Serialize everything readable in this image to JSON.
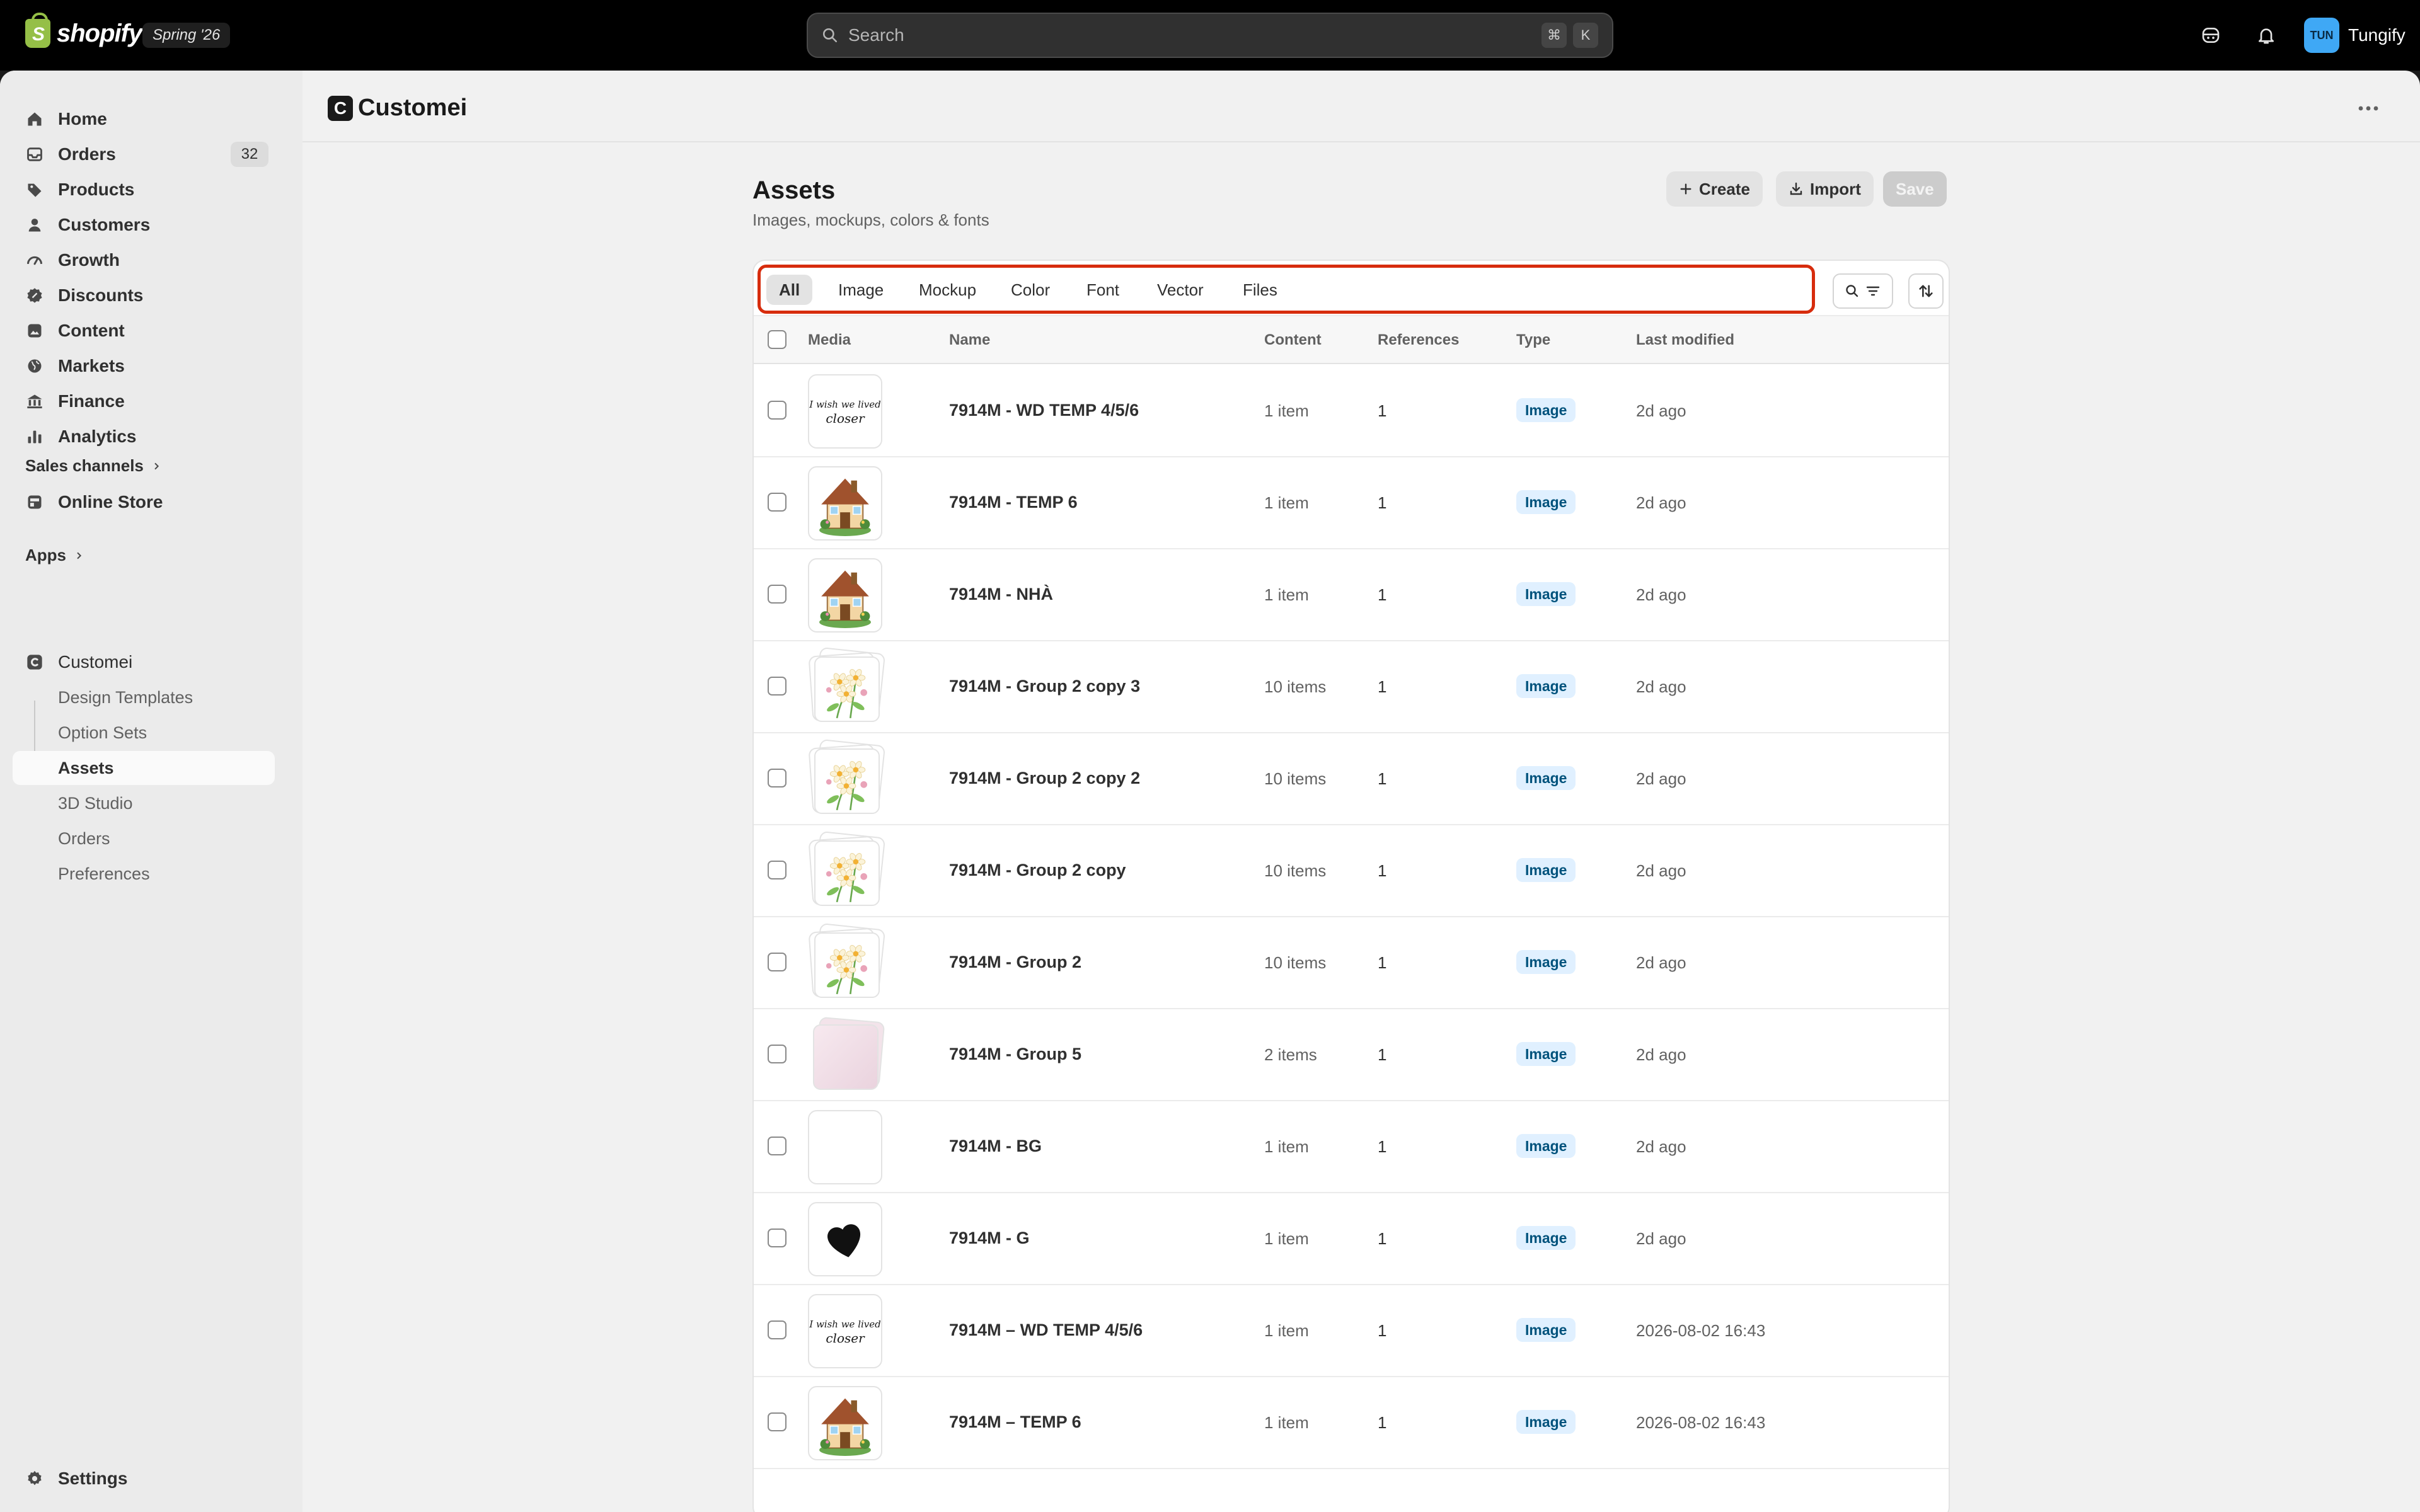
{
  "topbar": {
    "brand": "shopify",
    "brand_initial": "S",
    "edition": "Spring '26",
    "search_placeholder": "Search",
    "shortcut_keys": [
      "⌘",
      "K"
    ],
    "user_initials": "TUN",
    "user_name": "Tungify"
  },
  "sidebar": {
    "items": [
      {
        "label": "Home",
        "icon": "home-icon"
      },
      {
        "label": "Orders",
        "icon": "orders-icon",
        "badge": "32"
      },
      {
        "label": "Products",
        "icon": "tag-icon"
      },
      {
        "label": "Customers",
        "icon": "person-icon"
      },
      {
        "label": "Growth",
        "icon": "gauge-icon"
      },
      {
        "label": "Discounts",
        "icon": "discount-icon"
      },
      {
        "label": "Content",
        "icon": "content-icon"
      },
      {
        "label": "Markets",
        "icon": "globe-icon"
      },
      {
        "label": "Finance",
        "icon": "bank-icon"
      },
      {
        "label": "Analytics",
        "icon": "bar-chart-icon"
      }
    ],
    "sales_channels_label": "Sales channels",
    "online_store_label": "Online Store",
    "apps_label": "Apps",
    "app_name": "Customei",
    "app_sub_items": [
      "Design Templates",
      "Option Sets",
      "Assets",
      "3D Studio",
      "Orders",
      "Preferences"
    ],
    "active_sub_item": "Assets",
    "settings_label": "Settings"
  },
  "app_header": {
    "logo_letter": "C",
    "title": "Customei"
  },
  "page": {
    "title": "Assets",
    "subtitle": "Images, mockups, colors & fonts",
    "create_label": "Create",
    "import_label": "Import",
    "save_label": "Save"
  },
  "tabs": [
    "All",
    "Image",
    "Mockup",
    "Color",
    "Font",
    "Vector",
    "Files"
  ],
  "active_tab": "All",
  "table": {
    "columns": [
      "Media",
      "Name",
      "Content",
      "References",
      "Type",
      "Last modified"
    ],
    "rows": [
      {
        "name": "7914M - WD TEMP 4/5/6",
        "content": "1 item",
        "references": "1",
        "type": "Image",
        "modified": "2d ago",
        "thumb": "script-text"
      },
      {
        "name": "7914M - TEMP 6",
        "content": "1 item",
        "references": "1",
        "type": "Image",
        "modified": "2d ago",
        "thumb": "house"
      },
      {
        "name": "7914M - NHÀ",
        "content": "1 item",
        "references": "1",
        "type": "Image",
        "modified": "2d ago",
        "thumb": "house"
      },
      {
        "name": "7914M - Group 2 copy 3",
        "content": "10 items",
        "references": "1",
        "type": "Image",
        "modified": "2d ago",
        "thumb": "flowers-stack"
      },
      {
        "name": "7914M - Group 2 copy 2",
        "content": "10 items",
        "references": "1",
        "type": "Image",
        "modified": "2d ago",
        "thumb": "flowers-stack"
      },
      {
        "name": "7914M - Group 2 copy",
        "content": "10 items",
        "references": "1",
        "type": "Image",
        "modified": "2d ago",
        "thumb": "flowers-stack"
      },
      {
        "name": "7914M - Group 2",
        "content": "10 items",
        "references": "1",
        "type": "Image",
        "modified": "2d ago",
        "thumb": "flowers-stack"
      },
      {
        "name": "7914M - Group 5",
        "content": "2 items",
        "references": "1",
        "type": "Image",
        "modified": "2d ago",
        "thumb": "pink-stack"
      },
      {
        "name": "7914M - BG",
        "content": "1 item",
        "references": "1",
        "type": "Image",
        "modified": "2d ago",
        "thumb": "blank"
      },
      {
        "name": "7914M - G",
        "content": "1 item",
        "references": "1",
        "type": "Image",
        "modified": "2d ago",
        "thumb": "heart"
      },
      {
        "name": "7914M – WD TEMP 4/5/6",
        "content": "1 item",
        "references": "1",
        "type": "Image",
        "modified": "2026-08-02 16:43",
        "thumb": "script-text"
      },
      {
        "name": "7914M – TEMP 6",
        "content": "1 item",
        "references": "1",
        "type": "Image",
        "modified": "2026-08-02 16:43",
        "thumb": "house"
      }
    ]
  },
  "thumb_text": {
    "line1": "I wish we lived",
    "line2": "closer"
  },
  "colors": {
    "accent_highlight": "#d72c0d",
    "badge_bg": "#e0f0ff",
    "badge_text": "#00527c",
    "brand_green": "#95bf47"
  }
}
